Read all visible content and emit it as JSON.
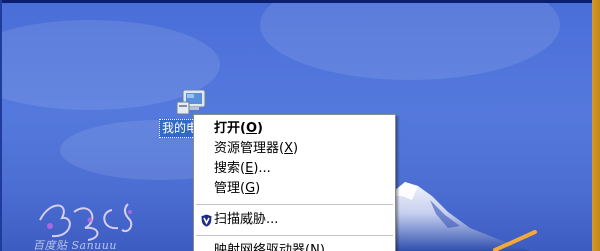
{
  "desktop": {
    "icon": {
      "name": "mycomputer-icon",
      "label": "我的电脑"
    }
  },
  "context_menu": {
    "items": [
      {
        "text": "打开",
        "key": "O",
        "suffix": "",
        "bold": true
      },
      {
        "text": "资源管理器",
        "key": "X",
        "suffix": ""
      },
      {
        "text": "搜索",
        "key": "E",
        "suffix": "..."
      },
      {
        "text": "管理",
        "key": "G",
        "suffix": ""
      },
      {
        "text": "扫描威胁...",
        "key": "",
        "suffix": "",
        "icon": "shield-icon"
      },
      {
        "text": "映射网络驱动器",
        "key": "N",
        "suffix": "..."
      }
    ]
  },
  "watermark": {
    "text": "百度贴 Sanuuu"
  },
  "colors": {
    "desktop": "#5479dd",
    "selection": "#3169c6",
    "frame_right": "#c68419"
  }
}
